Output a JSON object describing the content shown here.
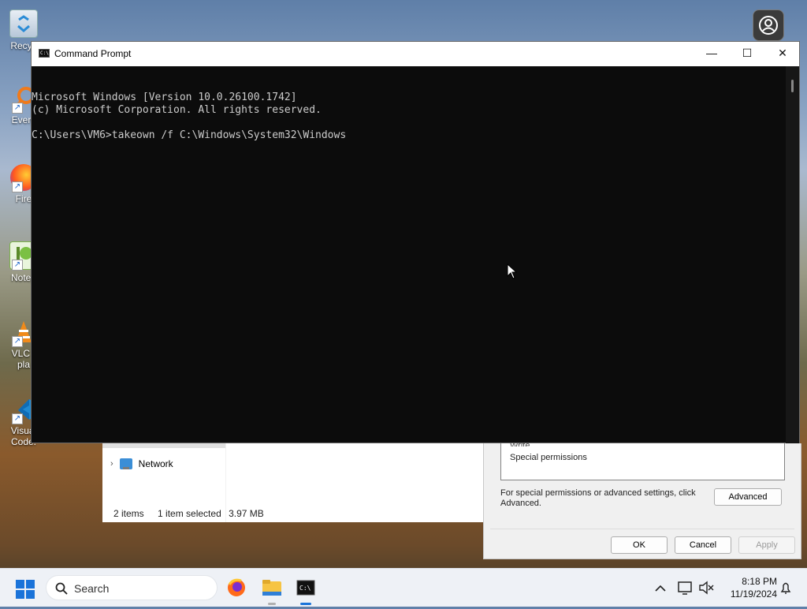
{
  "desktop": {
    "icons": [
      {
        "label": "Recycle Bin",
        "visible_label": "Recyc"
      },
      {
        "label": "Everything",
        "visible_label": "Every"
      },
      {
        "label": "Firefox",
        "visible_label": "Fire"
      },
      {
        "label": "Notepad++",
        "visible_label": "Notep"
      },
      {
        "label": "VLC media player",
        "visible_label_1": "VLC r",
        "visible_label_2": "pla"
      },
      {
        "label": "Visual Studio Code",
        "visible_label_1": "Visual",
        "visible_label_2": "Code."
      }
    ]
  },
  "cmd": {
    "title": "Command Prompt",
    "icon_text": "C:\\",
    "lines": [
      "Microsoft Windows [Version 10.0.26100.1742]",
      "(c) Microsoft Corporation. All rights reserved.",
      "",
      "C:\\Users\\VM6>takeown /f C:\\Windows\\System32\\Windows"
    ],
    "minimize": "—",
    "maximize": "☐",
    "close": "✕"
  },
  "explorer": {
    "nav_item": "Network",
    "status": {
      "items": "2 items",
      "selected": "1 item selected",
      "size": "3.97 MB"
    }
  },
  "properties": {
    "perm_partial": "Write",
    "perm_special": "Special permissions",
    "note": "For special permissions or advanced settings, click Advanced.",
    "advanced_label": "Advanced",
    "ok_label": "OK",
    "cancel_label": "Cancel",
    "apply_label": "Apply"
  },
  "taskbar": {
    "search_placeholder": "Search",
    "time": "8:18 PM",
    "date": "11/19/2024",
    "accent": "#1a73d9"
  }
}
